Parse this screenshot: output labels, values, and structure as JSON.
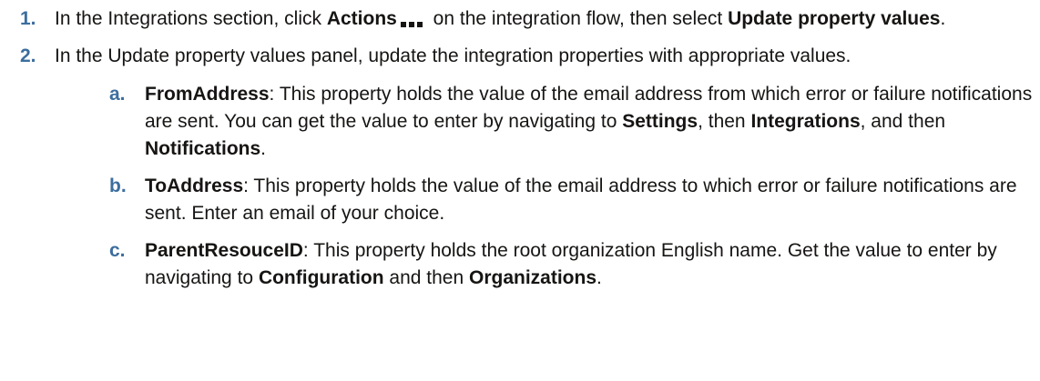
{
  "steps": [
    {
      "number": "1.",
      "t1": "In the Integrations section, click ",
      "b1": "Actions",
      "t2": " on the integration flow, then select ",
      "b2": "Update property values",
      "t3": "."
    },
    {
      "number": "2.",
      "text": "In the Update property values panel, update the integration properties with appropriate values.",
      "substeps": [
        {
          "letter": "a.",
          "term": "FromAddress",
          "t1": ": This property holds the value of the email address from which error or failure notifications are sent. You can get the value to enter by navigating to ",
          "b1": "Settings",
          "t2": ", then ",
          "b2": "Integrations",
          "t3": ", and then ",
          "b3": "Notifications",
          "t4": "."
        },
        {
          "letter": "b.",
          "term": "ToAddress",
          "t1": ": This property holds the value of the email address to which error or failure notifications are sent. Enter an email of your choice."
        },
        {
          "letter": "c.",
          "term": "ParentResouceID",
          "t1": ": This property holds the root organization English name. Get the value to enter by navigating to ",
          "b1": "Configuration",
          "t2": " and then ",
          "b2": "Organizations",
          "t3": "."
        }
      ]
    }
  ],
  "icons": {
    "actions": "ellipsis-icon"
  },
  "colors": {
    "step_number": "#3c6e9e",
    "text": "#161513"
  }
}
